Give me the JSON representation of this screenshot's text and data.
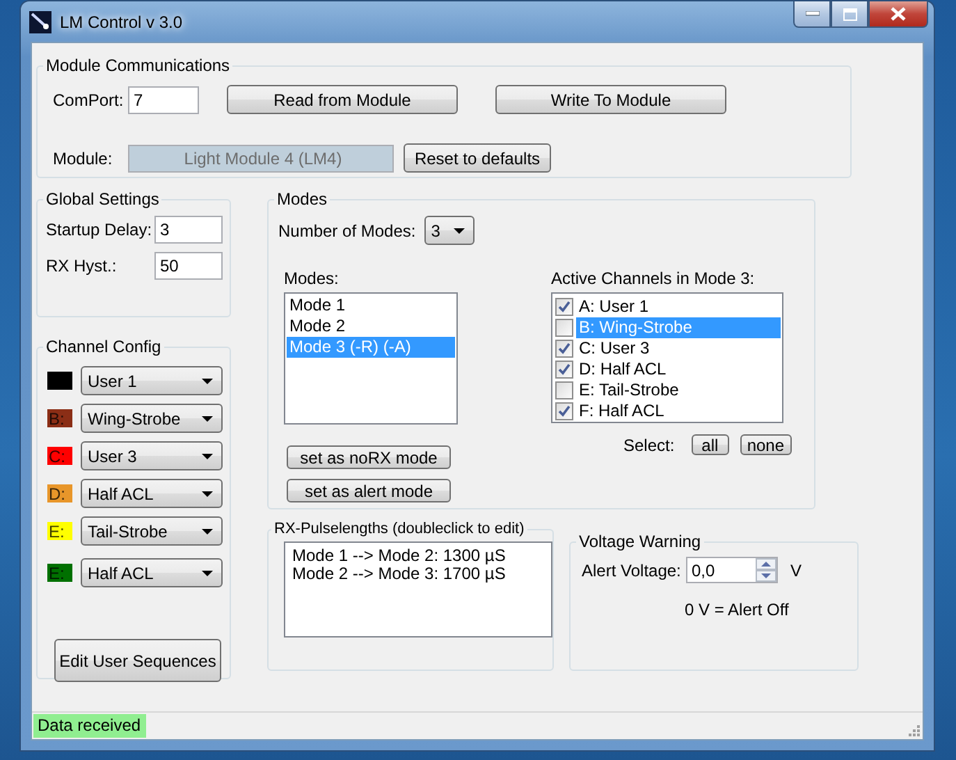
{
  "window": {
    "title": "LM Control v 3.0"
  },
  "module_communications": {
    "title": "Module Communications",
    "comport_label": "ComPort:",
    "comport": "7",
    "read_button": "Read from Module",
    "write_button": "Write To Module",
    "module_label": "Module:",
    "module": "Light Module 4 (LM4)",
    "reset_button": "Reset to defaults"
  },
  "global_settings": {
    "title": "Global Settings",
    "fields": [
      {
        "label": "Startup Delay:",
        "value": "3"
      },
      {
        "label": "RX Hyst.:",
        "value": "50"
      }
    ]
  },
  "channel_config": {
    "title": "Channel Config",
    "channels": [
      {
        "color": "#000000",
        "value": "User 1"
      },
      {
        "label": "B:",
        "color": "#8b2e16",
        "value": "Wing-Strobe"
      },
      {
        "label": "C:",
        "color": "#ff0000",
        "value": "User 3"
      },
      {
        "label": "D:",
        "color": "#e8962a",
        "value": "Half ACL"
      },
      {
        "label": "E:",
        "color": "#ffff00",
        "value": "Tail-Strobe"
      },
      {
        "label": "E:",
        "color": "#007000",
        "value": "Half ACL"
      }
    ],
    "button": "Edit User Sequences"
  },
  "modes": {
    "title": "Modes",
    "count_label": "Number of Modes:",
    "count": "3",
    "list_label": "Modes:",
    "items": [
      {
        "text": "Mode 1",
        "selected": false
      },
      {
        "text": "Mode 2",
        "selected": false
      },
      {
        "text": "Mode 3 (-R) (-A)",
        "selected": true
      }
    ],
    "buttons": [
      "set as noRX mode",
      "set as alert mode"
    ],
    "active_label": "Active Channels in Mode 3:",
    "channels": [
      {
        "text": "A: User 1",
        "checked": true,
        "selected": false
      },
      {
        "text": "B: Wing-Strobe",
        "checked": false,
        "selected": true
      },
      {
        "text": "C: User 3",
        "checked": true,
        "selected": false
      },
      {
        "text": "D: Half ACL",
        "checked": true,
        "selected": false
      },
      {
        "text": "E: Tail-Strobe",
        "checked": false,
        "selected": false
      },
      {
        "text": "F: Half ACL",
        "checked": true,
        "selected": false
      }
    ],
    "select_label": "Select:",
    "select_buttons": [
      "all",
      "none"
    ]
  },
  "rx_pulselengths": {
    "title": "RX-Pulselengths (doubleclick to edit)",
    "items": [
      "Mode 1 --> Mode 2: 1300 µS",
      "Mode 2 --> Mode 3: 1700 µS"
    ]
  },
  "voltage_warning": {
    "title": "Voltage Warning",
    "label": "Alert Voltage:",
    "value": "0,0",
    "unit": "V",
    "note": "0 V = Alert Off"
  },
  "status_bar": {
    "text": "Data received"
  }
}
